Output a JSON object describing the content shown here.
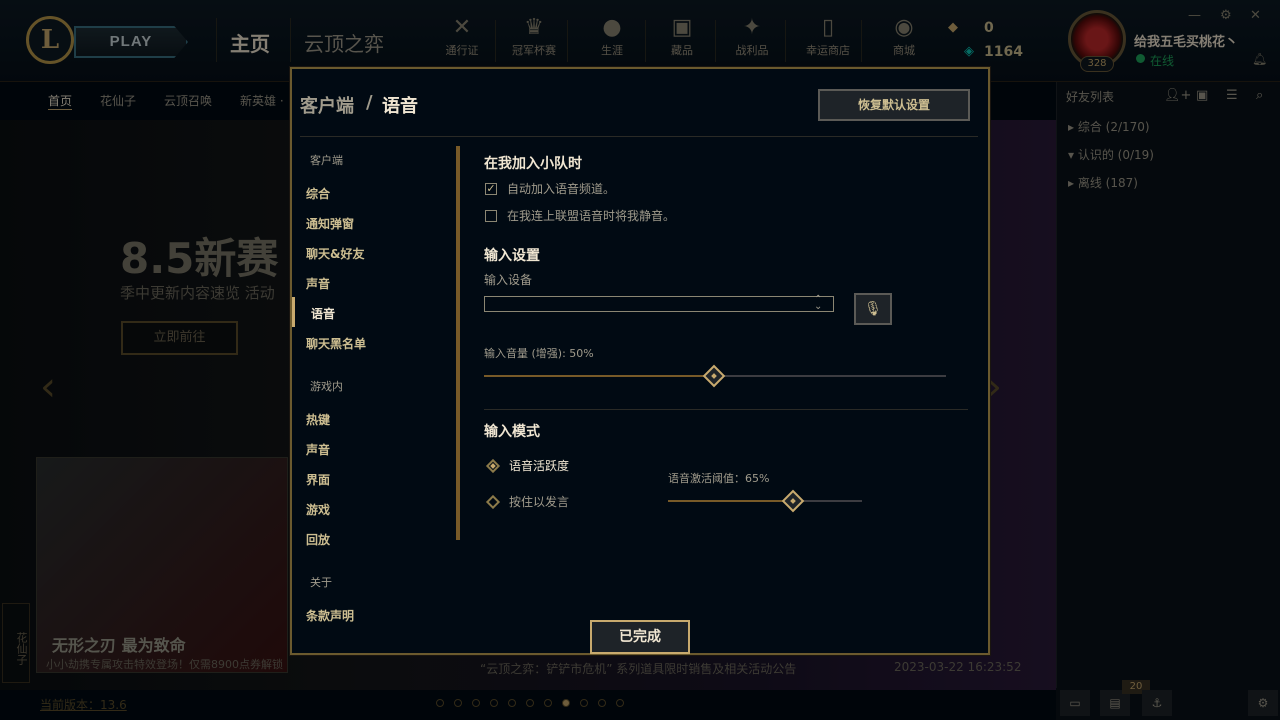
{
  "topbar": {
    "logo": "L",
    "play_label": "PLAY",
    "tabs": [
      {
        "label": "主页"
      },
      {
        "label": "云顶之弈"
      }
    ],
    "icons": [
      {
        "label": "通行证",
        "icon": "pass-icon",
        "glyph": "✕"
      },
      {
        "label": "冠军杯赛",
        "icon": "trophy-icon",
        "glyph": "♛"
      },
      {
        "label": "生涯",
        "icon": "profile-icon",
        "glyph": "●"
      },
      {
        "label": "藏品",
        "icon": "collection-icon",
        "glyph": "▣"
      },
      {
        "label": "战利品",
        "icon": "loot-icon",
        "glyph": "✦"
      },
      {
        "label": "幸运商店",
        "icon": "lucky-shop-icon",
        "glyph": "▯"
      },
      {
        "label": "商城",
        "icon": "store-icon",
        "glyph": "◉"
      }
    ],
    "currency_be": "0",
    "currency_rp": "1164",
    "user": {
      "name": "给我五毛买桃花丶",
      "status": "在线",
      "level": "328"
    }
  },
  "subnav": {
    "items": [
      {
        "label": "首页"
      },
      {
        "label": "花仙子"
      },
      {
        "label": "云顶召唤"
      },
      {
        "label": "新英雄 · "
      }
    ]
  },
  "hero": {
    "title": "8.5新赛",
    "subtitle": "季中更新内容速览 活动",
    "button": "立即前往",
    "card_title": "无形之刃 最为致命",
    "card_desc": "小小劫携专属攻击特效登场！仅需8900点券解锁",
    "news": "“云顶之弈：铲铲市危机” 系列道具限时销售及相关活动公告",
    "news_date": "2023-03-22 16:23:52",
    "version": "当前版本：13.6",
    "side_tag": "花仙子"
  },
  "friends": {
    "title": "好友列表",
    "groups": [
      {
        "label": "综合 (2/170)"
      },
      {
        "label": "认识的 (0/19)"
      },
      {
        "label": "离线 (187)"
      }
    ],
    "badge": "20"
  },
  "modal": {
    "title_section": "客户端",
    "title_page": "语音",
    "reset_label": "恢复默认设置",
    "sidebar": {
      "section_client": "客户端",
      "client_items": [
        {
          "label": "综合"
        },
        {
          "label": "通知弹窗"
        },
        {
          "label": "聊天&好友"
        },
        {
          "label": "声音"
        },
        {
          "label": "语音"
        },
        {
          "label": "聊天黑名单"
        }
      ],
      "section_ingame": "游戏内",
      "ingame_items": [
        {
          "label": "热键"
        },
        {
          "label": "声音"
        },
        {
          "label": "界面"
        },
        {
          "label": "游戏"
        },
        {
          "label": "回放"
        }
      ],
      "section_about": "关于",
      "about_items": [
        {
          "label": "条款声明"
        }
      ]
    },
    "party": {
      "heading": "在我加入小队时",
      "auto_join": {
        "label": "自动加入语音频道。",
        "checked": true
      },
      "mute_on_join": {
        "label": "在我连上联盟语音时将我静音。",
        "checked": false
      }
    },
    "input": {
      "heading": "输入设置",
      "device_label": "输入设备",
      "device_value": "",
      "volume_label": "输入音量 (增强): 50%",
      "volume": 50
    },
    "mode": {
      "heading": "输入模式",
      "voice_activity": "语音活跃度",
      "push_to_talk": "按住以发言",
      "selected": "voice_activity",
      "threshold_label": "语音激活阈值：65%",
      "threshold": 65
    },
    "done_label": "已完成"
  },
  "colors": {
    "gold": "#c8aa6e",
    "bg": "#010a13",
    "online": "#1ea55b"
  }
}
